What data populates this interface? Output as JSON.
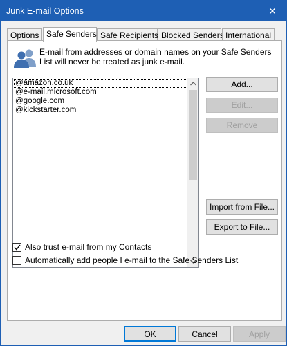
{
  "window": {
    "title": "Junk E-mail Options",
    "close_glyph": "✕"
  },
  "tabs": [
    {
      "label": "Options",
      "active": false
    },
    {
      "label": "Safe Senders",
      "active": true
    },
    {
      "label": "Safe Recipients",
      "active": false
    },
    {
      "label": "Blocked Senders",
      "active": false
    },
    {
      "label": "International",
      "active": false
    }
  ],
  "panel": {
    "info_text": "E-mail from addresses or domain names on your Safe Senders List will never be treated as junk e-mail.",
    "senders": [
      "@amazon.co.uk",
      "@e-mail.microsoft.com",
      "@google.com",
      "@kickstarter.com"
    ],
    "buttons": {
      "add": "Add...",
      "edit": "Edit...",
      "remove": "Remove",
      "import": "Import from File...",
      "export": "Export to File..."
    },
    "checkboxes": {
      "trust_contacts": {
        "label": "Also trust e-mail from my Contacts",
        "checked": true
      },
      "auto_add": {
        "label": "Automatically add people I e-mail to the Safe Senders List",
        "checked": false
      }
    }
  },
  "footer": {
    "ok": "OK",
    "cancel": "Cancel",
    "apply": "Apply"
  },
  "colors": {
    "titlebar": "#1e5fb4",
    "accent": "#0078d7",
    "icon_blue": "#5b8dc9"
  }
}
